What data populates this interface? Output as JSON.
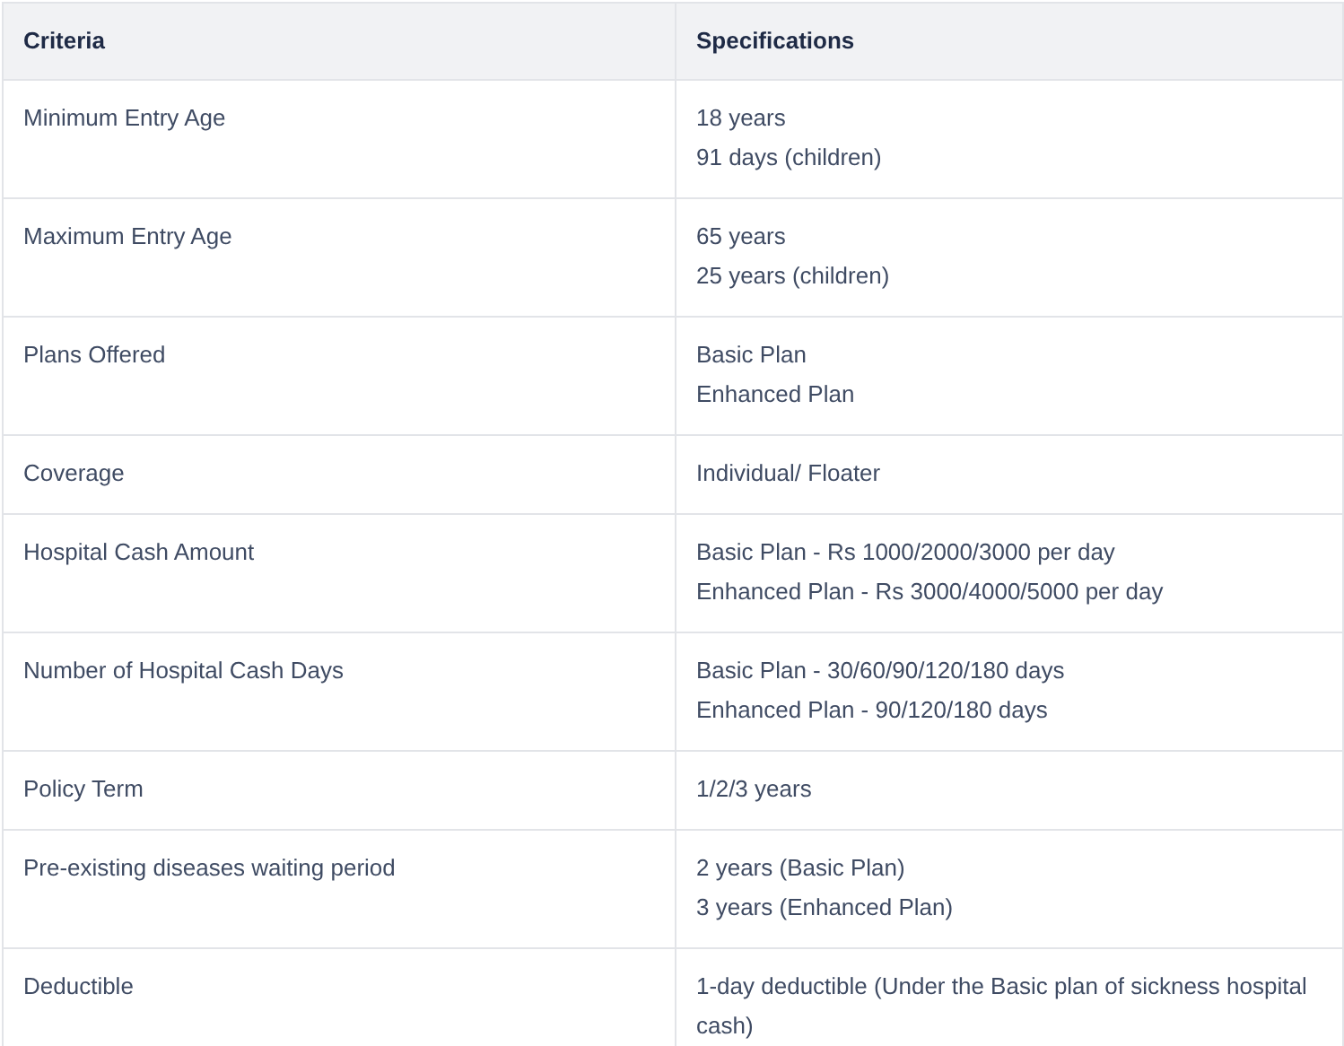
{
  "table": {
    "columns": [
      "Criteria",
      "Specifications"
    ],
    "rows": [
      {
        "criteria": "Minimum Entry Age",
        "specifications": [
          "18 years",
          "91 days (children)"
        ]
      },
      {
        "criteria": "Maximum Entry Age",
        "specifications": [
          "65 years",
          "25 years (children)"
        ]
      },
      {
        "criteria": "Plans Offered",
        "specifications": [
          "Basic Plan",
          "Enhanced Plan"
        ]
      },
      {
        "criteria": "Coverage",
        "specifications": [
          "Individual/ Floater"
        ]
      },
      {
        "criteria": "Hospital Cash Amount",
        "specifications": [
          "Basic Plan - Rs 1000/2000/3000 per day",
          "Enhanced Plan - Rs 3000/4000/5000 per day"
        ]
      },
      {
        "criteria": "Number of Hospital Cash Days",
        "specifications": [
          "Basic Plan - 30/60/90/120/180 days",
          "Enhanced Plan - 90/120/180 days"
        ]
      },
      {
        "criteria": "Policy Term",
        "specifications": [
          "1/2/3 years"
        ]
      },
      {
        "criteria": "Pre-existing diseases waiting period",
        "specifications": [
          "2 years (Basic Plan)",
          "3 years (Enhanced Plan)"
        ]
      },
      {
        "criteria": "Deductible",
        "specifications": [
          "1-day deductible (Under the Basic plan of sickness hospital cash)"
        ]
      }
    ]
  }
}
